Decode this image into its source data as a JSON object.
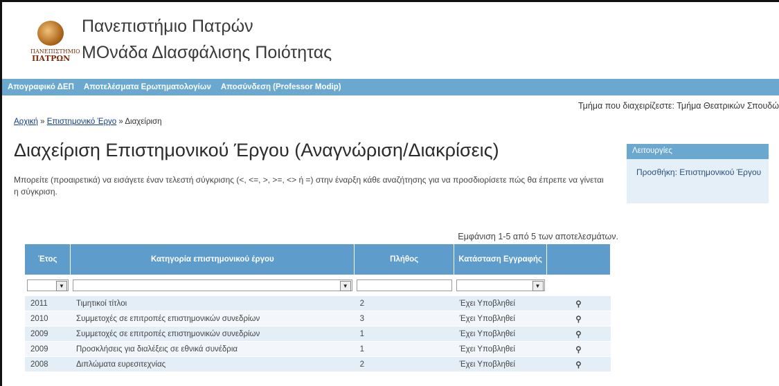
{
  "header": {
    "line1": "Πανεπιστήμιο Πατρών",
    "line2": "ΜΟνάδα Δlασφάλισης Ποιότητας",
    "logo_text_small": "ΠΑΝΕΠΙΣΤΗΜΙΟ",
    "logo_text_large": "ΠΑΤΡΩΝ"
  },
  "nav": {
    "items": [
      {
        "label": "Απογραφικό ΔΕΠ"
      },
      {
        "label": "Αποτελέσματα Ερωτηματολογίων"
      },
      {
        "label": "Αποσύνδεση (Professor Modip)"
      }
    ]
  },
  "department": "Τμήμα που διαχειρίζεστε: Τμήμα Θεατρικών Σπουδώ",
  "breadcrumb": {
    "home": "Αρχική",
    "sep1": " » ",
    "section": "Επιστημονικό Έργο",
    "sep2": " » ",
    "current": "Διαχείριση"
  },
  "page_title": "Διαχείριση Επιστημονικού Έργου (Αναγνώριση/Διακρίσεις)",
  "intro": "Μπορείτε (προαιρετικά) να εισάγετε έναν τελεστή σύγκρισης (<, <=, >, >=, <> ή =) στην έναρξη κάθε αναζήτησης για να προσδιορίσετε πώς θα έπρεπε να γίνεται η σύγκριση.",
  "operations": {
    "title": "Λειτουργίες",
    "link": "Προσθήκη: Επιστημονικού Έργου"
  },
  "summary": "Εμφάνιση 1-5 από 5 των αποτελεσμάτων.",
  "table": {
    "headers": [
      "Έτος",
      "Κατηγορία επιστημονικού έργου",
      "Πλήθος",
      "Κατάσταση Εγγραφής",
      ""
    ],
    "rows": [
      {
        "year": "2011",
        "category": "Τιμητικοί τίτλοι",
        "count": "2",
        "status": "Έχει Υποβληθεί"
      },
      {
        "year": "2010",
        "category": "Συμμετοχές σε επιτροπές επιστημονικών συνεδρίων",
        "count": "3",
        "status": "Έχει Υποβληθεί"
      },
      {
        "year": "2009",
        "category": "Συμμετοχές σε επιτροπές επιστημονικών συνεδρίων",
        "count": "1",
        "status": "Έχει Υποβληθεί"
      },
      {
        "year": "2009",
        "category": "Προσκλήσεις για διαλέξεις σε εθνικά συνέδρια",
        "count": "1",
        "status": "Έχει Υποβληθεί"
      },
      {
        "year": "2008",
        "category": "Διπλώματα ευρεσιτεχνίας",
        "count": "2",
        "status": "Έχει Υποβληθεί"
      }
    ]
  },
  "colors": {
    "nav_bg": "#6aa8d0",
    "table_header_bg": "#5d9ccb",
    "row_even": "#e3eef7",
    "row_odd": "#f3f7fb",
    "link": "#0d3d8a"
  },
  "icons": {
    "view": "magnifier-icon",
    "dropdown": "chevron-down-icon"
  }
}
